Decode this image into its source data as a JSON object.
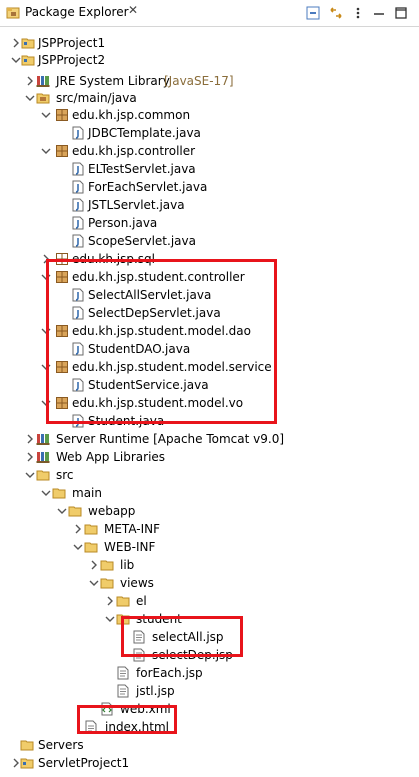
{
  "view": {
    "title": "Package Explorer",
    "close_glyph": "✕",
    "toolbar": [
      "collapse-all-icon",
      "link-with-editor-icon",
      "view-menu-icon",
      "minimize-icon",
      "maximize-icon"
    ]
  },
  "tree": [
    {
      "label": "JSPProject1",
      "decoration": "",
      "icon": "project-icon",
      "expanded": false
    },
    {
      "label": "JSPProject2",
      "decoration": "",
      "icon": "project-icon",
      "expanded": true
    },
    {
      "label": "JRE System Library",
      "decoration": "[JavaSE-17]",
      "icon": "library-icon",
      "expanded": false
    },
    {
      "label": "src/main/java",
      "decoration": "",
      "icon": "source-folder-icon",
      "expanded": true
    },
    {
      "label": "edu.kh.jsp.common",
      "decoration": "",
      "icon": "package-icon",
      "expanded": true
    },
    {
      "label": "JDBCTemplate.java",
      "decoration": "",
      "icon": "java-file-icon",
      "expanded": false
    },
    {
      "label": "edu.kh.jsp.controller",
      "decoration": "",
      "icon": "package-icon",
      "expanded": true
    },
    {
      "label": "ELTestServlet.java",
      "decoration": "",
      "icon": "java-file-icon",
      "expanded": false
    },
    {
      "label": "ForEachServlet.java",
      "decoration": "",
      "icon": "java-file-icon",
      "expanded": false
    },
    {
      "label": "JSTLServlet.java",
      "decoration": "",
      "icon": "java-file-icon",
      "expanded": false
    },
    {
      "label": "Person.java",
      "decoration": "",
      "icon": "java-file-icon",
      "expanded": false
    },
    {
      "label": "ScopeServlet.java",
      "decoration": "",
      "icon": "java-file-icon",
      "expanded": false
    },
    {
      "label": "edu.kh.jsp.sql",
      "decoration": "",
      "icon": "empty-package-icon",
      "expanded": false
    },
    {
      "label": "edu.kh.jsp.student.controller",
      "decoration": "",
      "icon": "package-icon",
      "expanded": true
    },
    {
      "label": "SelectAllServlet.java",
      "decoration": "",
      "icon": "java-file-icon",
      "expanded": false
    },
    {
      "label": "SelectDepServlet.java",
      "decoration": "",
      "icon": "java-file-icon",
      "expanded": false
    },
    {
      "label": "edu.kh.jsp.student.model.dao",
      "decoration": "",
      "icon": "package-icon",
      "expanded": true
    },
    {
      "label": "StudentDAO.java",
      "decoration": "",
      "icon": "java-file-icon",
      "expanded": false
    },
    {
      "label": "edu.kh.jsp.student.model.service",
      "decoration": "",
      "icon": "package-icon",
      "expanded": true
    },
    {
      "label": "StudentService.java",
      "decoration": "",
      "icon": "java-file-icon",
      "expanded": false
    },
    {
      "label": "edu.kh.jsp.student.model.vo",
      "decoration": "",
      "icon": "package-icon",
      "expanded": true
    },
    {
      "label": "Student.java",
      "decoration": "",
      "icon": "java-file-icon",
      "expanded": false
    },
    {
      "label": "Server Runtime [Apache Tomcat v9.0]",
      "decoration": "",
      "icon": "library-icon",
      "expanded": false
    },
    {
      "label": "Web App Libraries",
      "decoration": "",
      "icon": "library-icon",
      "expanded": false
    },
    {
      "label": "src",
      "decoration": "",
      "icon": "folder-icon",
      "expanded": true
    },
    {
      "label": "main",
      "decoration": "",
      "icon": "folder-icon",
      "expanded": true
    },
    {
      "label": "webapp",
      "decoration": "",
      "icon": "folder-icon",
      "expanded": true
    },
    {
      "label": "META-INF",
      "decoration": "",
      "icon": "folder-icon",
      "expanded": false
    },
    {
      "label": "WEB-INF",
      "decoration": "",
      "icon": "folder-icon",
      "expanded": true
    },
    {
      "label": "lib",
      "decoration": "",
      "icon": "folder-icon",
      "expanded": false
    },
    {
      "label": "views",
      "decoration": "",
      "icon": "folder-icon",
      "expanded": true
    },
    {
      "label": "el",
      "decoration": "",
      "icon": "folder-icon",
      "expanded": false
    },
    {
      "label": "student",
      "decoration": "",
      "icon": "folder-icon",
      "expanded": true
    },
    {
      "label": "selectAll.jsp",
      "decoration": "",
      "icon": "jsp-file-icon",
      "expanded": false
    },
    {
      "label": "selectDep.jsp",
      "decoration": "",
      "icon": "jsp-file-icon",
      "expanded": false
    },
    {
      "label": "forEach.jsp",
      "decoration": "",
      "icon": "jsp-file-icon",
      "expanded": false
    },
    {
      "label": "jstl.jsp",
      "decoration": "",
      "icon": "jsp-file-icon",
      "expanded": false
    },
    {
      "label": "web.xml",
      "decoration": "",
      "icon": "xml-file-icon",
      "expanded": false
    },
    {
      "label": "index.html",
      "decoration": "",
      "icon": "html-file-icon",
      "expanded": false
    },
    {
      "label": "Servers",
      "decoration": "",
      "icon": "folder-icon",
      "expanded": false
    },
    {
      "label": "ServletProject1",
      "decoration": "",
      "icon": "project-icon",
      "expanded": false
    }
  ],
  "colors": {
    "highlight": "#e8141b",
    "folder": "#e7b84a",
    "java": "#3a6fb0",
    "package": "#b5773a"
  }
}
